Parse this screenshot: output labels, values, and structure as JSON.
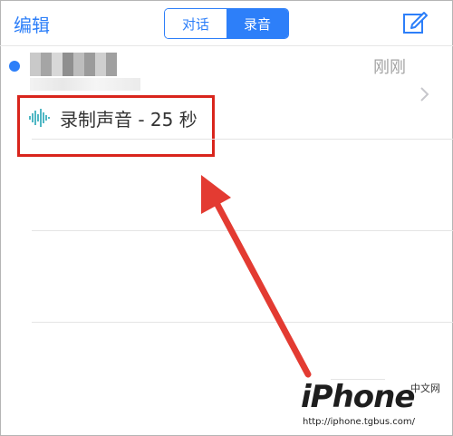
{
  "nav": {
    "edit_label": "编辑",
    "segments": [
      {
        "label": "对话",
        "selected": false
      },
      {
        "label": "录音",
        "selected": true
      }
    ],
    "compose_icon": "compose-icon"
  },
  "conversation": {
    "time": "刚刚",
    "unread": true,
    "preview_icon": "audio-waveform-icon",
    "preview_text": "录制声音 - 25 秒"
  },
  "watermark": {
    "logo": "iPhone",
    "cn": "中文网",
    "url": "http://iphone.tgbus.com/"
  },
  "colors": {
    "accent": "#2d7ff9",
    "highlight": "#d9251c",
    "wave": "#4fb7c4"
  }
}
